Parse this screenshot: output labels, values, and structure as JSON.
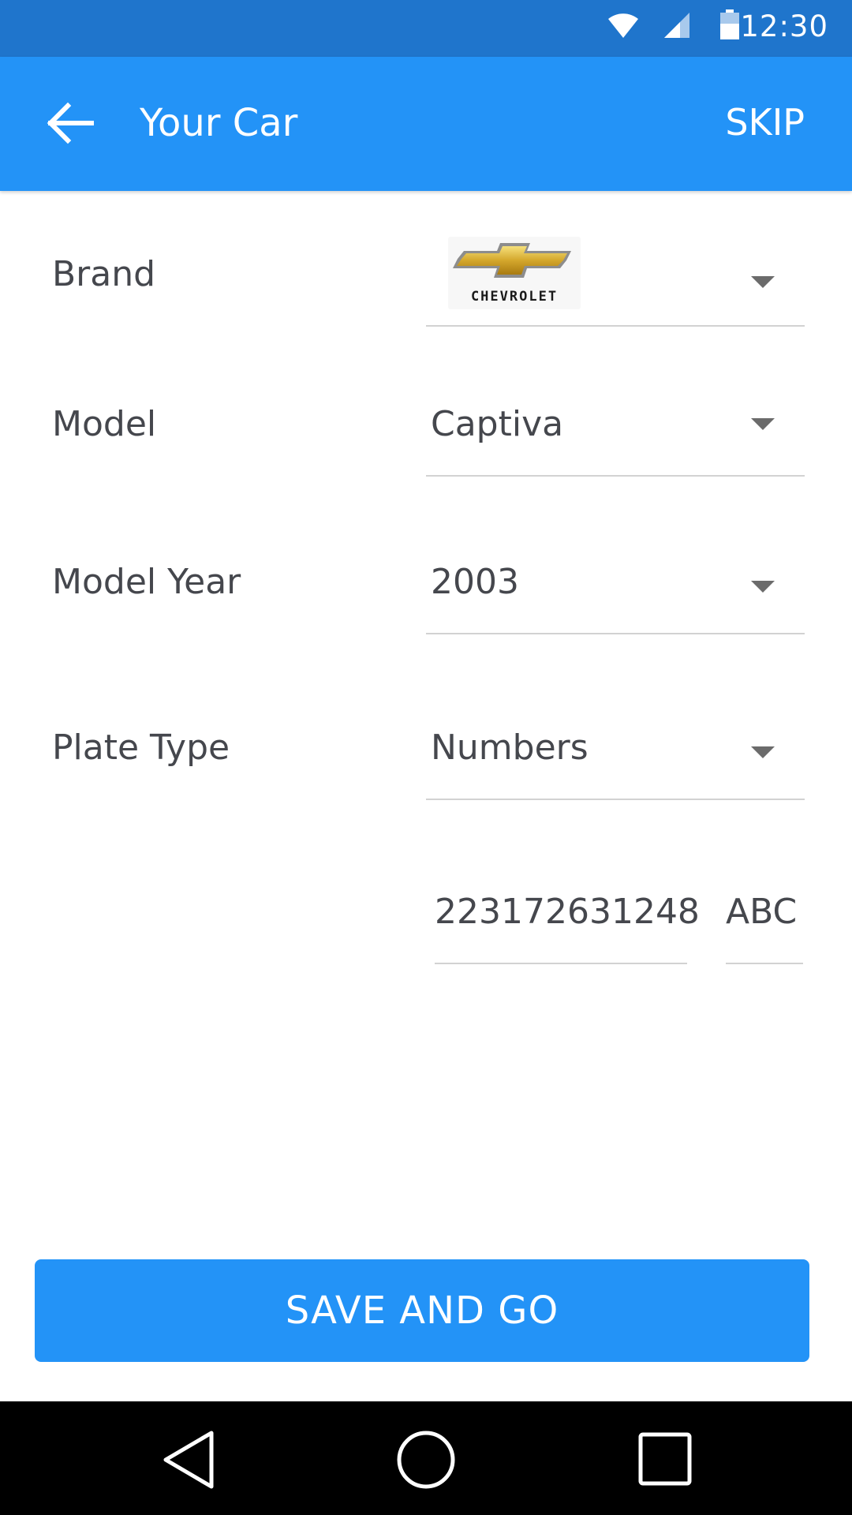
{
  "status_bar": {
    "time": "12:30",
    "icons": [
      "wifi-icon",
      "cellular-signal-icon",
      "battery-icon"
    ]
  },
  "app_bar": {
    "title": "Your Car",
    "back_icon": "arrow-left-icon",
    "skip_label": "SKIP"
  },
  "form": {
    "brand": {
      "label": "Brand",
      "value": "CHEVROLET",
      "value_display": "logo",
      "arrow_icon": "dropdown-arrow-icon"
    },
    "model": {
      "label": "Model",
      "value": "Captiva",
      "arrow_icon": "dropdown-arrow-icon"
    },
    "model_year": {
      "label": "Model Year",
      "value": "2003",
      "arrow_icon": "dropdown-arrow-icon"
    },
    "plate_type": {
      "label": "Plate Type",
      "value": "Numbers",
      "arrow_icon": "dropdown-arrow-icon"
    },
    "plate": {
      "number": "223172631248",
      "letters": "ABC"
    }
  },
  "save_button": {
    "label": "SAVE AND GO"
  },
  "nav_bar": {
    "icons": [
      "back-triangle-icon",
      "home-circle-icon",
      "recents-square-icon"
    ]
  },
  "colors": {
    "status_bar": "#1f75cc",
    "primary": "#2393f7",
    "text": "#45474d",
    "divider": "#d2d2d2",
    "nav_bar": "#000000"
  }
}
